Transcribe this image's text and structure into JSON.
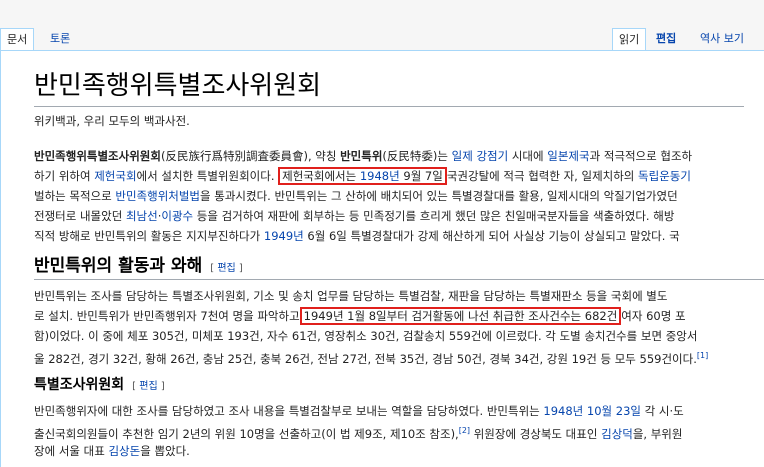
{
  "tabs": {
    "article": "문서",
    "talk": "토론",
    "read": "읽기",
    "edit": "편집",
    "history": "역사 보기"
  },
  "title": "반민족행위특별조사위원회",
  "sitesub": "위키백과, 우리 모두의 백과사전.",
  "intro": {
    "l1a": "반민족행위특별조사위원회",
    "l1b": "(反民族行爲特別調査委員會), 약칭 ",
    "l1c": "반민특위",
    "l1d": "(反民特委)는 ",
    "l1e": "일제 강점기",
    "l1f": " 시대에 ",
    "l1g": "일본제국",
    "l1h": "과 적극적으로 협조하",
    "l2a": "하기 위하여 ",
    "l2b": "제헌국회",
    "l2c": "에서 설치한 특별위원회이다. ",
    "l2d": "제헌국회에서는 ",
    "l2e": "1948년",
    "l2f": " 9월 7일",
    "l2g": "국권강탈에 적극 협력한 자, 일제치하의 ",
    "l2h": "독립운동기",
    "l3a": "벌하는 목적으로 ",
    "l3b": "반민족행위처벌법",
    "l3c": "을 통과시켰다. 반민특위는 그 산하에 배치되어 있는 특별경찰대를 활용, 일제시대의 악질기업가였던",
    "l4a": "전쟁터로 내몰았던 ",
    "l4b": "최남선",
    "l4c": "·",
    "l4d": "이광수",
    "l4e": " 등을 검거하여 재판에 회부하는 등 민족정기를 흐리게 했던 많은 친일매국분자들을 색출하였다. 해방",
    "l5a": "직적 방해로 반민특위의 활동은 지지부진하다가 ",
    "l5b": "1949년",
    "l5c": " 6월 6일 특별경찰대가 강제 해산하게 되어 사실상 기능이 상실되고 말았다. 국"
  },
  "sec1": {
    "heading": "반민특위의 활동과 와해",
    "edit": "편집",
    "l1": "반민특위는 조사를 담당하는 특별조사위원회, 기소 및 송치 업무를 담당하는 특별검찰, 재판을 담당하는 특별재판소 등을 국회에 별도",
    "l2a": "로 설치. 반민특위가 반민족행위자 7천여 명을 파악하고",
    "l2b": "1949년 1월 8일부터 검거활동에 나선 취급한 조사건수는 682건",
    "l2c": "여자 60명 포",
    "l3": "함)이었다. 이 중에 체포 305건, 미체포 193건, 자수 61건, 영장취소 30건, 검찰송치 559건에 이르렀다. 각 도별 송치건수를 보면 중앙서",
    "l4": "울 282건, 경기 32건, 황해 26건, 충남 25건, 충북 26건, 전남 27건, 전북 35건, 경남 50건, 경북 34건, 강원 19건 등 모두 559건이다.",
    "l4ref": "[1]"
  },
  "sec2": {
    "heading": "특별조사위원회",
    "edit": "편집",
    "l1a": "반민족행위자에 대한 조사를 담당하였고 조사 내용을 특별검찰부로 보내는 역할을 담당하였다. 반민특위는 ",
    "l1b": "1948년 10월 23일",
    "l1c": " 각 시·도",
    "l2a": "출신국회의원들이 추천한 임기 2년의 위원 10명을 선출하고(이 법 제9조, 제10조 참조),",
    "l2ref": "[2]",
    "l2b": " 위원장에 경상북도 대표인 ",
    "l2c": "김상덕",
    "l2d": "을, 부위원",
    "l3a": "장에 서울 대표 ",
    "l3b": "김상돈",
    "l3c": "을 뽑았다."
  }
}
